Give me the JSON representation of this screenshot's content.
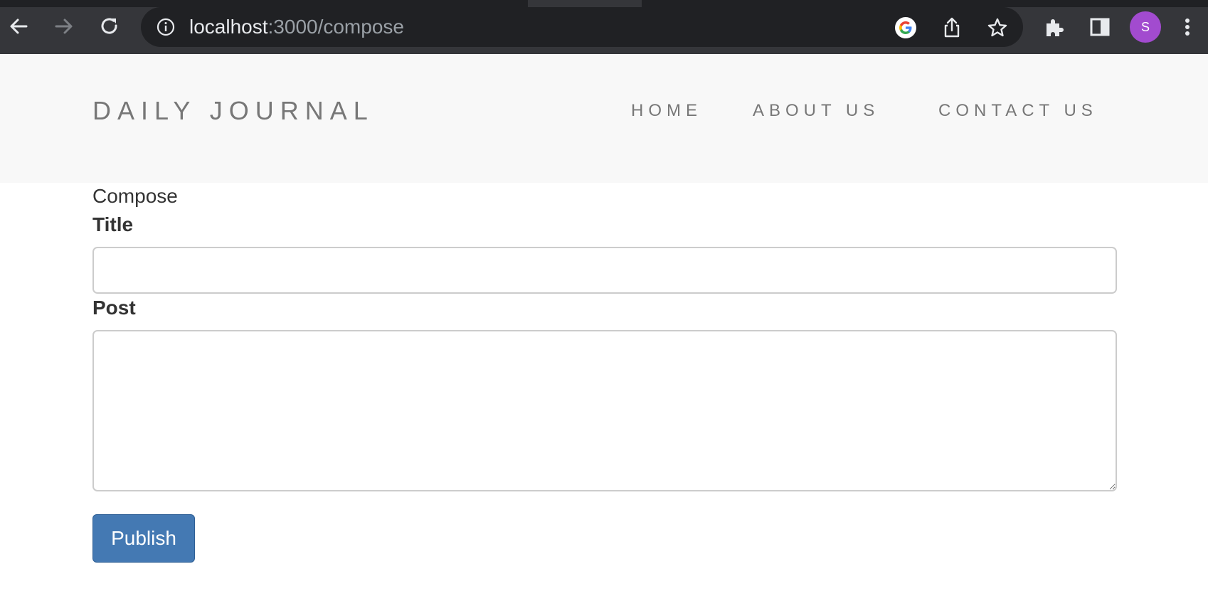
{
  "browser": {
    "url_host": "localhost",
    "url_path": ":3000/compose",
    "profile_initial": "S",
    "icons": {
      "back": "back-arrow-icon",
      "forward": "forward-arrow-icon",
      "reload": "reload-icon",
      "site_info": "info-icon",
      "google": "google-icon",
      "share": "share-icon",
      "bookmark": "star-icon",
      "extensions": "puzzle-icon",
      "side_panel": "side-panel-icon",
      "menu": "kebab-menu-icon"
    },
    "colors": {
      "frame": "#35363a",
      "omnibox": "#202124",
      "avatar": "#a24bcf"
    }
  },
  "site": {
    "brand": "DAILY JOURNAL",
    "nav": {
      "home": "HOME",
      "about": "ABOUT US",
      "contact": "CONTACT US"
    },
    "colors": {
      "header_bg": "#f8f8f8",
      "nav_text": "#777777",
      "button_bg": "#4479b3"
    }
  },
  "compose": {
    "heading": "Compose",
    "title_label": "Title",
    "title_value": "",
    "post_label": "Post",
    "post_value": "",
    "publish_label": "Publish"
  }
}
